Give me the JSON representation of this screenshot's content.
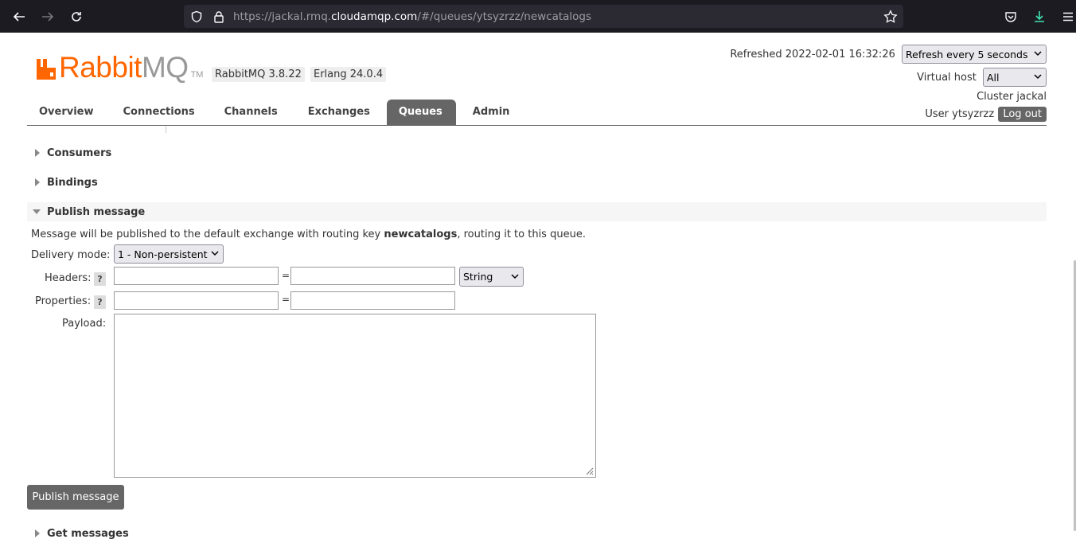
{
  "browser": {
    "url_prefix": "https://jackal.rmq.",
    "url_host": "cloudamqp.com",
    "url_path": "/#/queues/ytsyzrzz/newcatalogs"
  },
  "header": {
    "logo_rabbit": "RabbitMQ",
    "logo_tm": "TM",
    "rabbitmq_version": "RabbitMQ 3.8.22",
    "erlang_version": "Erlang 24.0.4",
    "refreshed": "Refreshed 2022-02-01 16:32:26",
    "refresh_select": "Refresh every 5 seconds",
    "vhost_label": "Virtual host",
    "vhost_select": "All",
    "cluster": "Cluster jackal",
    "user": "User ytsyzrzz",
    "logout": "Log out"
  },
  "tabs": [
    {
      "label": "Overview"
    },
    {
      "label": "Connections"
    },
    {
      "label": "Channels"
    },
    {
      "label": "Exchanges"
    },
    {
      "label": "Queues"
    },
    {
      "label": "Admin"
    }
  ],
  "sections": {
    "consumers": "Consumers",
    "bindings": "Bindings",
    "publish": "Publish message",
    "get": "Get messages"
  },
  "publish": {
    "info_before": "Message will be published to the default exchange with routing key ",
    "routing_key": "newcatalogs",
    "info_after": ", routing it to this queue.",
    "delivery_label": "Delivery mode:",
    "delivery_value": "1 - Non-persistent",
    "headers_label": "Headers:",
    "properties_label": "Properties:",
    "payload_label": "Payload:",
    "help": "?",
    "eq": "=",
    "type_value": "String",
    "button": "Publish message"
  }
}
